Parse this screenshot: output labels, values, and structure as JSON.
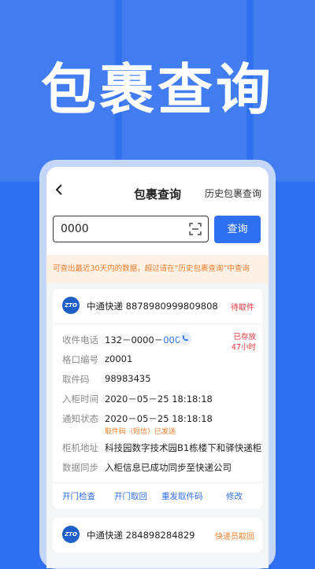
{
  "hero": {
    "title": "包裹查询"
  },
  "nav": {
    "title": "包裹查询",
    "history": "历史包裹查询"
  },
  "search": {
    "value": "0000",
    "button": "查询"
  },
  "notice": "可查出最近30天内的数据，超过请在“历史包裹查询”中查询",
  "colors": {
    "brand": "#2f6ff0",
    "warn": "#f07d2c",
    "danger": "#e8353c"
  },
  "cards": [
    {
      "logo": "ZTO",
      "courier": "中通快递 8878980999809808",
      "status": "待取件",
      "stored_line1": "已存放",
      "stored_line2": "47小时",
      "phone_label": "收件电话",
      "phone_value": "132－0000－",
      "phone_highlight": "0000",
      "slot_label": "格口编号",
      "slot_value": "z0001",
      "code_label": "取件码",
      "code_value": "98983435",
      "time_label": "入柜时间",
      "time_value": "2020－05－25  18:18:18",
      "notify_label": "通知状态",
      "notify_value": "2020－05－25  18:18:18",
      "notify_sub": "取件码（短信）已发送",
      "addr_label": "柜机地址",
      "addr_value": "科技园数字技术园B1栋楼下和驿快递柜",
      "sync_label": "数据同步",
      "sync_value": "入柜信息已成功同步至快递公司",
      "actions": [
        "开门检查",
        "开门取回",
        "重发取件码",
        "修改"
      ]
    },
    {
      "logo": "ZTO",
      "courier": "中通快递 284898284829",
      "status": "快递员取回"
    }
  ]
}
